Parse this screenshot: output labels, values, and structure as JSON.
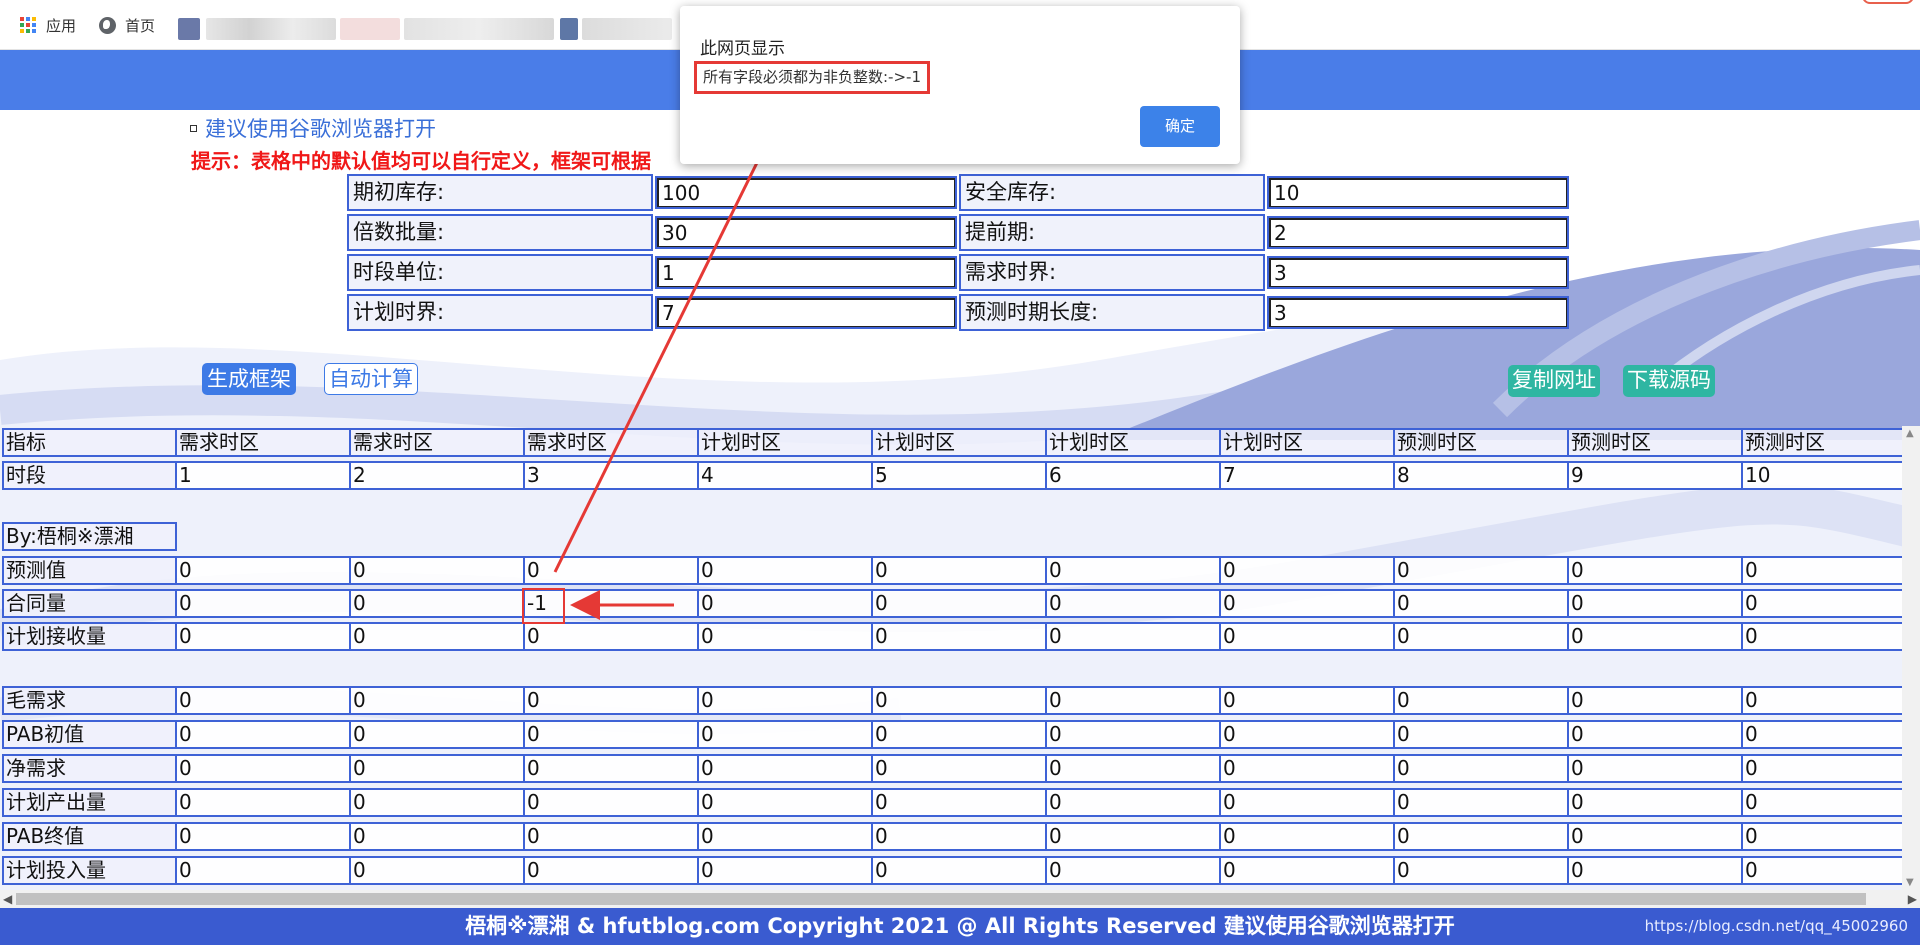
{
  "bookmarks": {
    "apps_label": "应用",
    "home_label": "首页"
  },
  "page": {
    "browser_hint": "建议使用谷歌浏览器打开",
    "tip": "提示：表格中的默认值均可以自行定义，框架可根据",
    "config": [
      {
        "label": "期初库存:",
        "value": "100",
        "label2": "安全库存:",
        "value2": "10"
      },
      {
        "label": "倍数批量:",
        "value": "30",
        "label2": "提前期:",
        "value2": "2"
      },
      {
        "label": "时段单位:",
        "value": "1",
        "label2": "需求时界:",
        "value2": "3"
      },
      {
        "label": "计划时界:",
        "value": "7",
        "label2": "预测时期长度:",
        "value2": "3"
      }
    ],
    "buttons": {
      "generate": "生成框架",
      "auto_calc": "自动计算",
      "copy_url": "复制网址",
      "download": "下载源码"
    }
  },
  "grid": {
    "header_label": "指标",
    "header_cols": [
      "需求时区",
      "需求时区",
      "需求时区",
      "计划时区",
      "计划时区",
      "计划时区",
      "计划时区",
      "预测时区",
      "预测时区",
      "预测时区"
    ],
    "period_label": "时段",
    "periods": [
      "1",
      "2",
      "3",
      "4",
      "5",
      "6",
      "7",
      "8",
      "9",
      "10"
    ],
    "author": "By:梧桐※漂湘",
    "input_rows": [
      {
        "label": "预测值",
        "values": [
          "0",
          "0",
          "0",
          "0",
          "0",
          "0",
          "0",
          "0",
          "0",
          "0"
        ]
      },
      {
        "label": "合同量",
        "values": [
          "0",
          "0",
          "-1",
          "0",
          "0",
          "0",
          "0",
          "0",
          "0",
          "0"
        ]
      },
      {
        "label": "计划接收量",
        "values": [
          "0",
          "0",
          "0",
          "0",
          "0",
          "0",
          "0",
          "0",
          "0",
          "0"
        ]
      }
    ],
    "output_rows": [
      {
        "label": "毛需求",
        "values": [
          "0",
          "0",
          "0",
          "0",
          "0",
          "0",
          "0",
          "0",
          "0",
          "0"
        ]
      },
      {
        "label": "PAB初值",
        "values": [
          "0",
          "0",
          "0",
          "0",
          "0",
          "0",
          "0",
          "0",
          "0",
          "0"
        ]
      },
      {
        "label": "净需求",
        "values": [
          "0",
          "0",
          "0",
          "0",
          "0",
          "0",
          "0",
          "0",
          "0",
          "0"
        ]
      },
      {
        "label": "计划产出量",
        "values": [
          "0",
          "0",
          "0",
          "0",
          "0",
          "0",
          "0",
          "0",
          "0",
          "0"
        ]
      },
      {
        "label": "PAB终值",
        "values": [
          "0",
          "0",
          "0",
          "0",
          "0",
          "0",
          "0",
          "0",
          "0",
          "0"
        ]
      },
      {
        "label": "计划投入量",
        "values": [
          "0",
          "0",
          "0",
          "0",
          "0",
          "0",
          "0",
          "0",
          "0",
          "0"
        ]
      }
    ]
  },
  "footer": {
    "text": "梧桐※漂湘 & hfutblog.com Copyright 2021 @ All Rights Reserved 建议使用谷歌浏览器打开",
    "watermark": "https://blog.csdn.net/qq_45002960"
  },
  "dialog": {
    "title": "此网页显示",
    "message": "所有字段必须都为非负整数:->-1",
    "ok": "确定"
  },
  "colors": {
    "header_band": "#4a7de8",
    "grid_border": "#3e62d6",
    "tip_red": "#f01818",
    "teal_button": "#2fb6a2",
    "annotation_red": "#e53935"
  }
}
